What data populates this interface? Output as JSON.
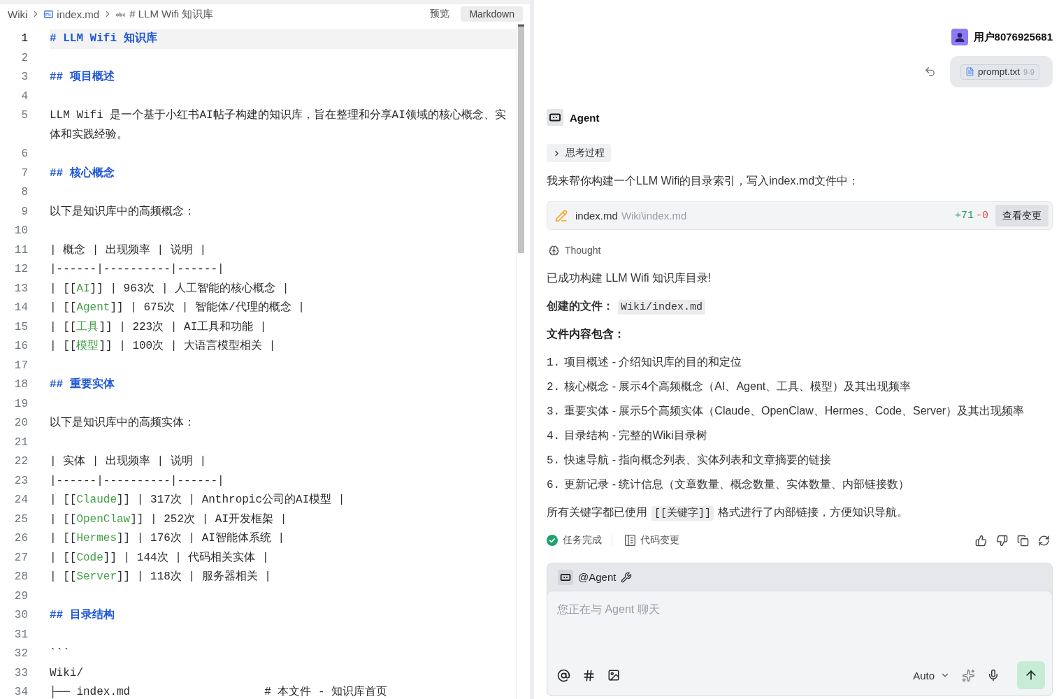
{
  "breadcrumb": [
    {
      "kind": "folder",
      "label": "Wiki"
    },
    {
      "kind": "markdown",
      "label": "index.md"
    },
    {
      "kind": "symbol",
      "label": "# LLM Wifi 知识库"
    }
  ],
  "view_modes": [
    {
      "label": "预览",
      "selected": false
    },
    {
      "label": "Markdown",
      "selected": true
    }
  ],
  "editor": {
    "lines": [
      {
        "number": "1",
        "current": true,
        "segments": [
          {
            "kind": "heading",
            "text": "# LLM Wifi 知识库"
          }
        ]
      },
      {
        "number": "2",
        "current": false
      },
      {
        "number": "3",
        "current": false,
        "segments": [
          {
            "kind": "heading",
            "text": "## 项目概述"
          }
        ]
      },
      {
        "number": "4",
        "current": false
      },
      {
        "number": "5",
        "current": false,
        "segments": [
          {
            "kind": "text",
            "text": "LLM Wifi 是一个基于小红书AI帖子构建的知识库，旨在整理和分享AI领域的核心概念、实体和实践经验。"
          }
        ]
      },
      {
        "number": "6",
        "current": false
      },
      {
        "number": "7",
        "current": false,
        "segments": [
          {
            "kind": "heading",
            "text": "## 核心概念"
          }
        ]
      },
      {
        "number": "8",
        "current": false
      },
      {
        "number": "9",
        "current": false,
        "segments": [
          {
            "kind": "text",
            "text": "以下是知识库中的高频概念："
          }
        ]
      },
      {
        "number": "10",
        "current": false
      },
      {
        "number": "11",
        "current": false,
        "segments": [
          {
            "kind": "text",
            "text": "| 概念 | 出现频率 | 说明 |"
          }
        ]
      },
      {
        "number": "12",
        "current": false,
        "segments": [
          {
            "kind": "text",
            "text": "|------|----------|------|"
          }
        ]
      },
      {
        "number": "13",
        "current": false,
        "segments": [
          {
            "kind": "text",
            "text": "| [["
          },
          {
            "kind": "link",
            "text": "AI"
          },
          {
            "kind": "text",
            "text": "]] | 963次 | 人工智能的核心概念 |"
          }
        ]
      },
      {
        "number": "14",
        "current": false,
        "segments": [
          {
            "kind": "text",
            "text": "| [["
          },
          {
            "kind": "link",
            "text": "Agent"
          },
          {
            "kind": "text",
            "text": "]] | 675次 | 智能体/代理的概念 |"
          }
        ]
      },
      {
        "number": "15",
        "current": false,
        "segments": [
          {
            "kind": "text",
            "text": "| [["
          },
          {
            "kind": "link",
            "text": "工具"
          },
          {
            "kind": "text",
            "text": "]] | 223次 | AI工具和功能 |"
          }
        ]
      },
      {
        "number": "16",
        "current": false,
        "segments": [
          {
            "kind": "text",
            "text": "| [["
          },
          {
            "kind": "link",
            "text": "模型"
          },
          {
            "kind": "text",
            "text": "]] | 100次 | 大语言模型相关 |"
          }
        ]
      },
      {
        "number": "17",
        "current": false
      },
      {
        "number": "18",
        "current": false,
        "segments": [
          {
            "kind": "heading",
            "text": "## 重要实体"
          }
        ]
      },
      {
        "number": "19",
        "current": false
      },
      {
        "number": "20",
        "current": false,
        "segments": [
          {
            "kind": "text",
            "text": "以下是知识库中的高频实体："
          }
        ]
      },
      {
        "number": "21",
        "current": false
      },
      {
        "number": "22",
        "current": false,
        "segments": [
          {
            "kind": "text",
            "text": "| 实体 | 出现频率 | 说明 |"
          }
        ]
      },
      {
        "number": "23",
        "current": false,
        "segments": [
          {
            "kind": "text",
            "text": "|------|----------|------|"
          }
        ]
      },
      {
        "number": "24",
        "current": false,
        "segments": [
          {
            "kind": "text",
            "text": "| [["
          },
          {
            "kind": "link",
            "text": "Claude"
          },
          {
            "kind": "text",
            "text": "]] | 317次 | Anthropic公司的AI模型 |"
          }
        ]
      },
      {
        "number": "25",
        "current": false,
        "segments": [
          {
            "kind": "text",
            "text": "| [["
          },
          {
            "kind": "link",
            "text": "OpenClaw"
          },
          {
            "kind": "text",
            "text": "]] | 252次 | AI开发框架 |"
          }
        ]
      },
      {
        "number": "26",
        "current": false,
        "segments": [
          {
            "kind": "text",
            "text": "| [["
          },
          {
            "kind": "link",
            "text": "Hermes"
          },
          {
            "kind": "text",
            "text": "]] | 176次 | AI智能体系统 |"
          }
        ]
      },
      {
        "number": "27",
        "current": false,
        "segments": [
          {
            "kind": "text",
            "text": "| [["
          },
          {
            "kind": "link",
            "text": "Code"
          },
          {
            "kind": "text",
            "text": "]] | 144次 | 代码相关实体 |"
          }
        ]
      },
      {
        "number": "28",
        "current": false,
        "segments": [
          {
            "kind": "text",
            "text": "| [["
          },
          {
            "kind": "link",
            "text": "Server"
          },
          {
            "kind": "text",
            "text": "]] | 118次 | 服务器相关 |"
          }
        ]
      },
      {
        "number": "29",
        "current": false
      },
      {
        "number": "30",
        "current": false,
        "segments": [
          {
            "kind": "heading",
            "text": "## 目录结构"
          }
        ]
      },
      {
        "number": "31",
        "current": false
      },
      {
        "number": "32",
        "current": false,
        "segments": [
          {
            "kind": "text",
            "text": "```"
          }
        ]
      },
      {
        "number": "33",
        "current": false,
        "segments": [
          {
            "kind": "text",
            "text": "Wiki/"
          }
        ]
      },
      {
        "number": "34",
        "current": false,
        "segments": [
          {
            "kind": "text",
            "text": "├── index.md                    # 本文件 - 知识库首页"
          }
        ]
      }
    ]
  },
  "chat": {
    "user": {
      "name": "用户8076925681",
      "attachment": {
        "name": "prompt.txt",
        "range": "9-9"
      }
    },
    "agent": {
      "name": "Agent"
    },
    "thinking": {
      "label": "思考过程",
      "expanded": false
    },
    "intro": "我来帮你构建一个LLM Wifi的目录索引，写入index.md文件中：",
    "file_change": {
      "name": "index.md",
      "path": "Wiki\\index.md",
      "added": "+71",
      "removed": "-0",
      "action": "查看变更"
    },
    "thought": {
      "label": "Thought"
    },
    "message": [
      {
        "kind": "paragraph",
        "segments": [
          {
            "kind": "text",
            "text": "已成功构建 LLM Wifi 知识库目录!"
          }
        ]
      },
      {
        "kind": "paragraph",
        "segments": [
          {
            "kind": "bold",
            "text": "创建的文件："
          },
          {
            "kind": "code",
            "text": "Wiki/index.md"
          }
        ]
      },
      {
        "kind": "heading",
        "text": "文件内容包含："
      },
      {
        "kind": "list",
        "items": [
          {
            "marker": "1.",
            "text": "项目概述 - 介绍知识库的目的和定位"
          },
          {
            "marker": "2.",
            "text": "核心概念 - 展示4个高频概念（AI、Agent、工具、模型）及其出现频率"
          },
          {
            "marker": "3.",
            "text": "重要实体 - 展示5个高频实体（Claude、OpenClaw、Hermes、Code、Server）及其出现频率"
          },
          {
            "marker": "4.",
            "text": "目录结构 - 完整的Wiki目录树"
          },
          {
            "marker": "5.",
            "text": "快速导航 - 指向概念列表、实体列表和文章摘要的链接"
          },
          {
            "marker": "6.",
            "text": "更新记录 - 统计信息（文章数量、概念数量、实体数量、内部链接数）"
          }
        ]
      },
      {
        "kind": "paragraph",
        "segments": [
          {
            "kind": "text",
            "text": "所有关键字都已使用"
          },
          {
            "kind": "code",
            "text": "[[关键字]]"
          },
          {
            "kind": "text",
            "text": "格式进行了内部链接，方便知识导航。"
          }
        ]
      }
    ],
    "status": {
      "done": "任务完成",
      "changes": "代码变更"
    }
  },
  "composer": {
    "mention": "@Agent",
    "placeholder": "您正在与 Agent 聊天",
    "mode": "Auto"
  }
}
